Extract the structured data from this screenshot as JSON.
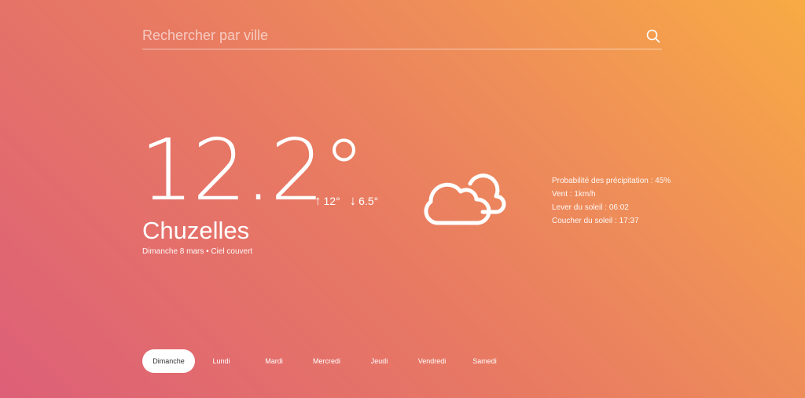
{
  "search": {
    "placeholder": "Rechercher par ville",
    "icon": "search-icon"
  },
  "current": {
    "temperature": "12.2°",
    "high": "12°",
    "low": "6.5°",
    "high_arrow": "↑",
    "low_arrow": "↓",
    "city": "Chuzelles",
    "date_line": "Dimanche 8 mars • Ciel couvert",
    "icon": "cloudy-icon"
  },
  "details": {
    "precipitation": "Probabilité des précipitation : 45%",
    "wind": "Vent : 1km/h",
    "sunrise": "Lever du soleil : 06:02",
    "sunset": "Coucher du soleil : 17:37"
  },
  "days": [
    {
      "label": "Dimanche",
      "active": true
    },
    {
      "label": "Lundi",
      "active": false
    },
    {
      "label": "Mardi",
      "active": false
    },
    {
      "label": "Mercredi",
      "active": false
    },
    {
      "label": "Jeudi",
      "active": false
    },
    {
      "label": "Vendredi",
      "active": false
    },
    {
      "label": "Samedi",
      "active": false
    }
  ],
  "colors": {
    "gradient_top_right": "#f8ab44",
    "gradient_bottom_left": "#dd5f78",
    "text": "#ffffff",
    "active_tab_text": "#333333"
  }
}
